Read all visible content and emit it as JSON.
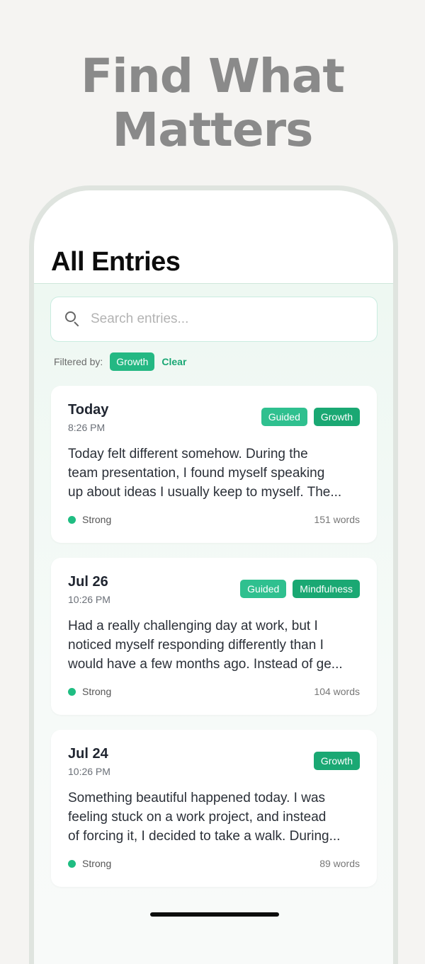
{
  "hero": {
    "line1": "Find What",
    "line2": "Matters"
  },
  "screen": {
    "title": "All Entries",
    "search": {
      "placeholder": "Search entries...",
      "value": ""
    },
    "filter": {
      "label": "Filtered by:",
      "chip": "Growth",
      "clear": "Clear"
    }
  },
  "entries": [
    {
      "date": "Today",
      "time": "8:26 PM",
      "tags": [
        "Guided",
        "Growth"
      ],
      "text": [
        "Today felt different somehow. During the",
        "team presentation, I found myself speaking",
        "up about ideas I usually keep to myself. The..."
      ],
      "strength": "Strong",
      "words": "151 words"
    },
    {
      "date": "Jul 26",
      "time": "10:26 PM",
      "tags": [
        "Guided",
        "Mindfulness"
      ],
      "text": [
        "Had a really challenging day at work, but I",
        "noticed myself responding differently than I",
        "would have a few months ago. Instead of ge..."
      ],
      "strength": "Strong",
      "words": "104 words"
    },
    {
      "date": "Jul 24",
      "time": "10:26 PM",
      "tags": [
        "Growth"
      ],
      "text": [
        "Something beautiful happened today. I was",
        "feeling stuck on a work project, and instead",
        "of forcing it, I decided to take a walk. During..."
      ],
      "strength": "Strong",
      "words": "89 words"
    }
  ],
  "colors": {
    "accent": "#24b883",
    "accent_dark": "#1aa873",
    "strength_dot": "#1fbd82"
  }
}
